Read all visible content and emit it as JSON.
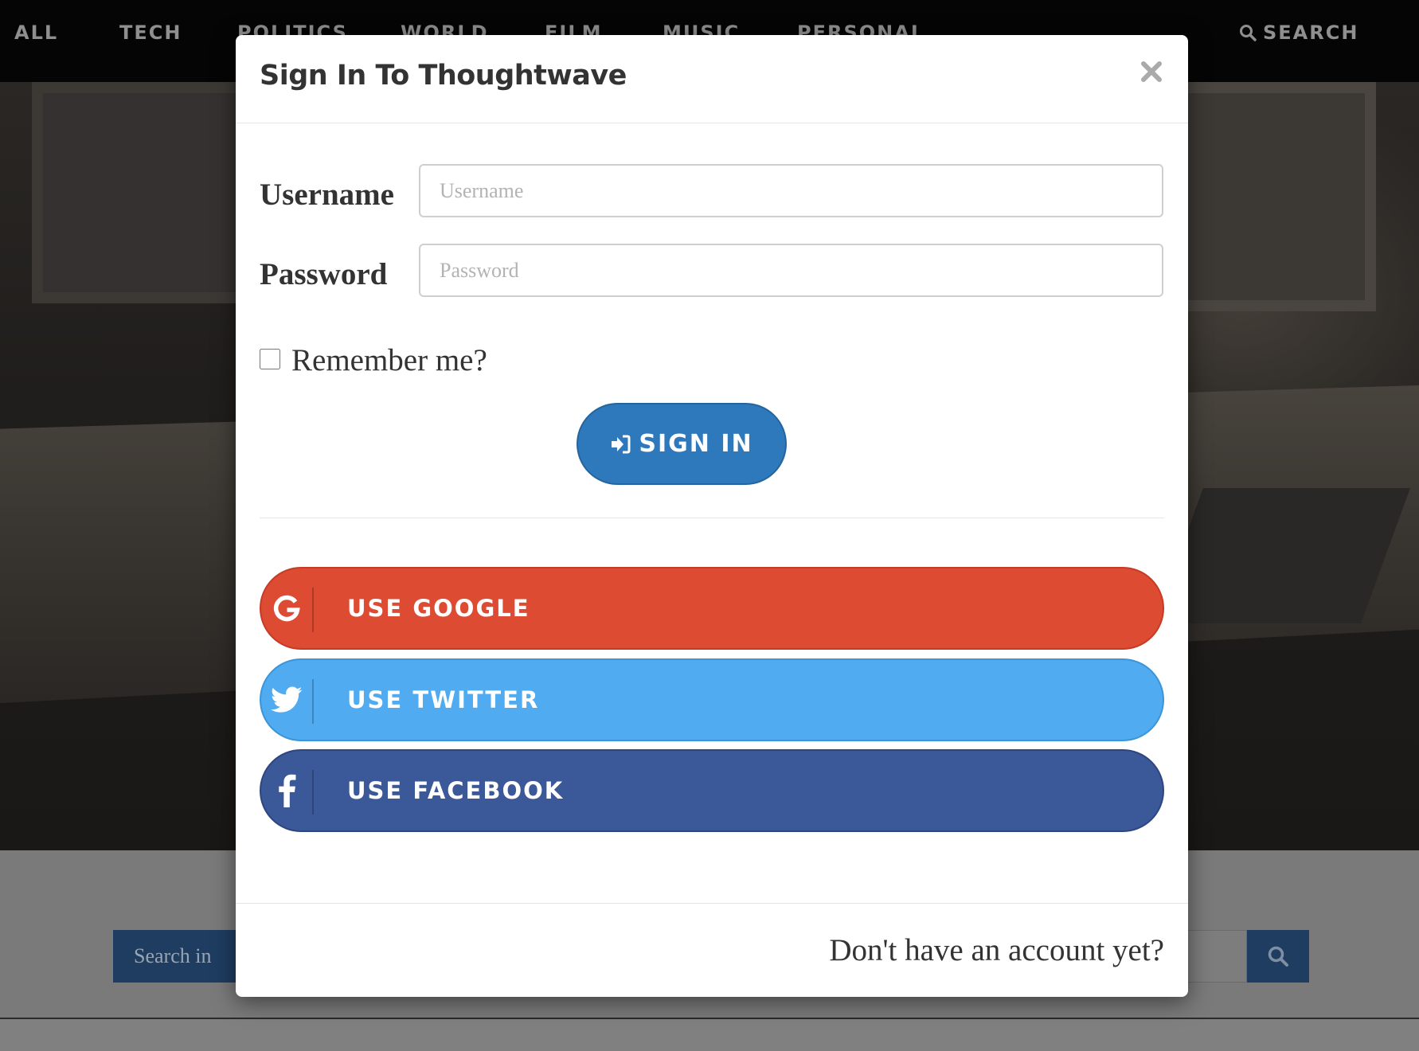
{
  "nav": {
    "items": [
      "ALL",
      "TECH",
      "POLITICS",
      "WORLD",
      "FILM",
      "MUSIC",
      "PERSONAL"
    ],
    "search_label": "SEARCH"
  },
  "background": {
    "search_in_label": "Search in"
  },
  "modal": {
    "title": "Sign In To Thoughtwave",
    "close_icon": "close-icon",
    "username_label": "Username",
    "username_placeholder": "Username",
    "username_value": "",
    "password_label": "Password",
    "password_placeholder": "Password",
    "password_value": "",
    "remember_label": "Remember me?",
    "remember_checked": false,
    "signin_label": "SIGN IN",
    "social": [
      {
        "label": "USE GOOGLE",
        "icon": "google-icon",
        "color": "#dd4b32"
      },
      {
        "label": "USE TWITTER",
        "icon": "twitter-icon",
        "color": "#50abf1"
      },
      {
        "label": "USE FACEBOOK",
        "icon": "facebook-icon",
        "color": "#3b5998"
      }
    ],
    "footer_link": "Don't have an account yet?"
  },
  "colors": {
    "primary": "#2e78bc",
    "nav_bg": "#050505",
    "overlay": "#808080"
  }
}
